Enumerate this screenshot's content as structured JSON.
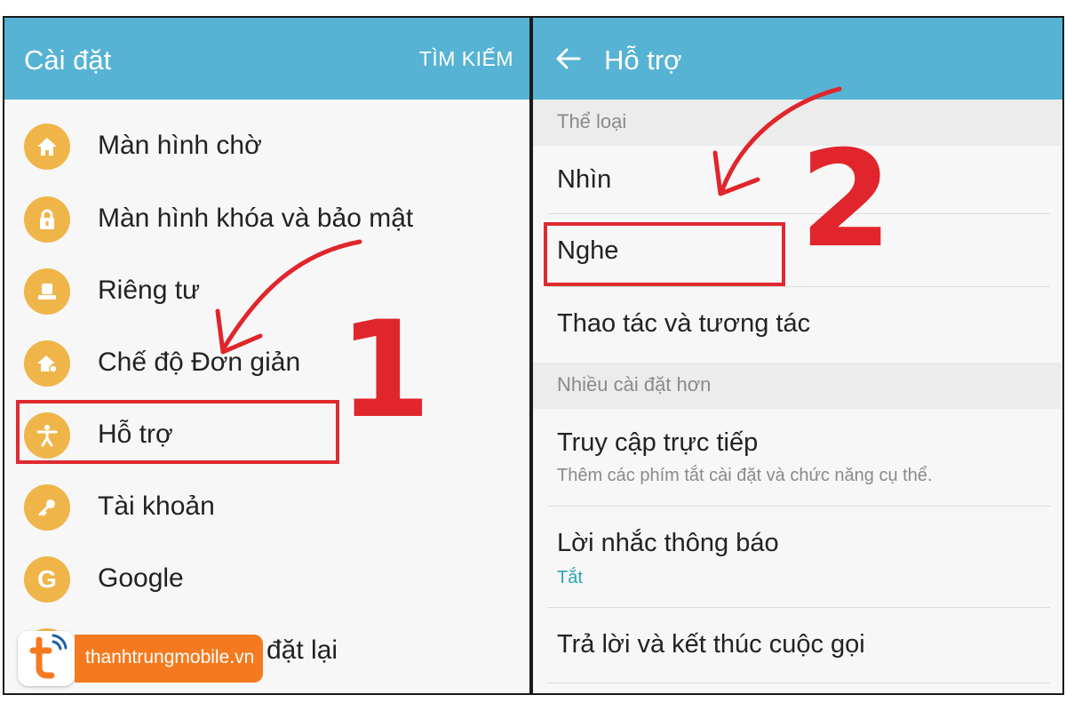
{
  "left_screen": {
    "title": "Cài đặt",
    "action": "TÌM KIẾM",
    "items": [
      {
        "label": "Màn hình chờ",
        "icon": "home-icon"
      },
      {
        "label": "Màn hình khóa và bảo mật",
        "icon": "lock-icon"
      },
      {
        "label": "Riêng tư",
        "icon": "privacy-icon"
      },
      {
        "label": "Chế độ Đơn giản",
        "icon": "easy-mode-icon"
      },
      {
        "label": "Hỗ trợ",
        "icon": "accessibility-icon"
      },
      {
        "label": "Tài khoản",
        "icon": "key-icon"
      },
      {
        "label": "Google",
        "icon": "google-icon"
      },
      {
        "label": "i đặt lại",
        "icon": "reset-icon"
      }
    ]
  },
  "right_screen": {
    "title": "Hỗ trợ",
    "sections": [
      {
        "header": "Thể loại",
        "items": [
          {
            "label": "Nhìn"
          },
          {
            "label": "Nghe"
          },
          {
            "label": "Thao tác và tương tác"
          }
        ]
      },
      {
        "header": "Nhiều cài đặt hơn",
        "items": [
          {
            "label": "Truy cập trực tiếp",
            "subtitle": "Thêm các phím tắt cài đặt và chức năng cụ thể."
          },
          {
            "label": "Lời nhắc thông báo",
            "status": "Tắt"
          },
          {
            "label": "Trả lời và kết thúc cuộc gọi"
          }
        ]
      }
    ]
  },
  "annotations": {
    "step1": "1",
    "step2": "2"
  },
  "watermark": {
    "text": "thanhtrungmobile.vn"
  },
  "colors": {
    "app_bar": "#56b3d3",
    "icon_bg": "#f0b549",
    "highlight": "#e02a2f",
    "status_text": "#2aa3b4",
    "brand_orange": "#f57a1f"
  }
}
